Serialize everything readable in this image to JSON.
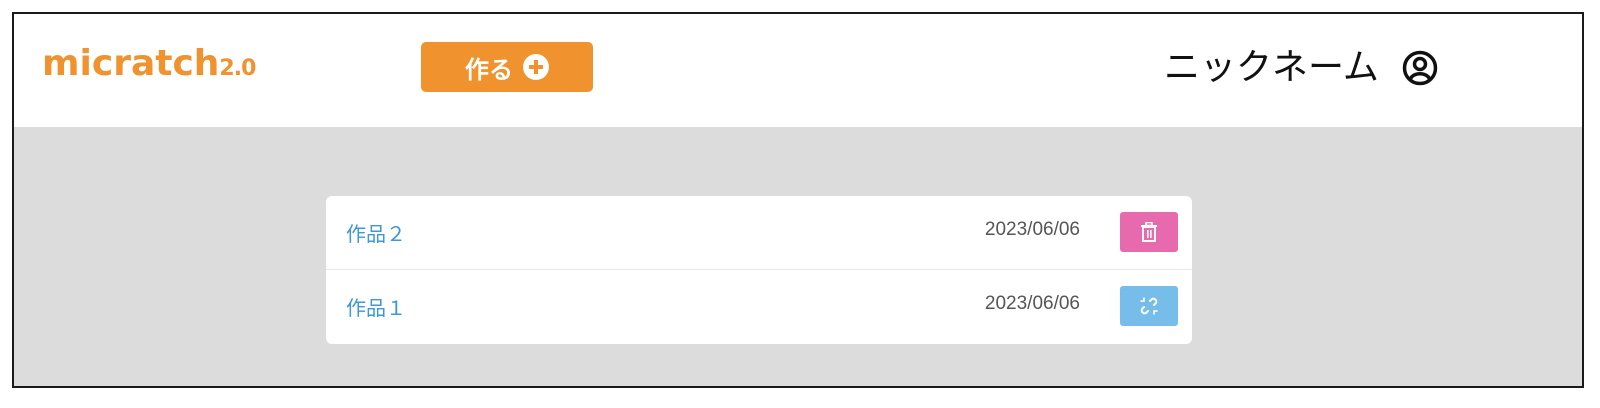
{
  "header": {
    "logo_text": "micratch",
    "logo_version": "2.0",
    "create_label": "作る",
    "nickname": "ニックネーム"
  },
  "works": [
    {
      "title": "作品２",
      "date": "2023/06/06",
      "action": "delete",
      "action_icon": "trash-icon",
      "action_color": "#e86aae"
    },
    {
      "title": "作品１",
      "date": "2023/06/06",
      "action": "unlink",
      "action_icon": "unlink-icon",
      "action_color": "#77bdea"
    }
  ],
  "colors": {
    "brand": "#f0922e",
    "link": "#3d97d8",
    "background": "#dcdcdc"
  }
}
